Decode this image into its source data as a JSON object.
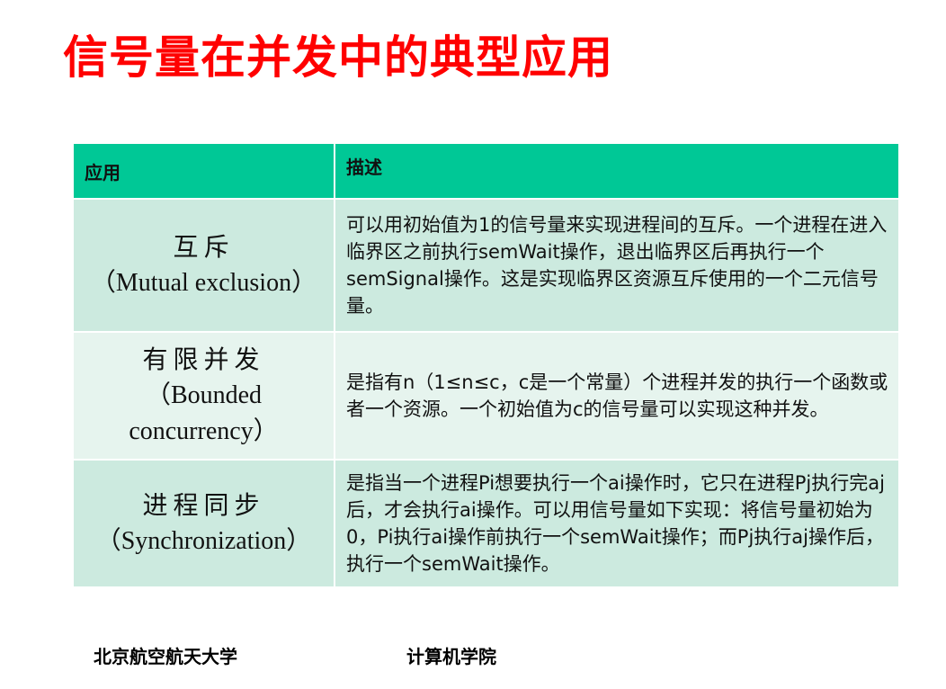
{
  "title": "信号量在并发中的典型应用",
  "table": {
    "headers": [
      "应用",
      "描述"
    ],
    "rows": [
      {
        "name_zh": "互斥",
        "name_en": "（Mutual exclusion）",
        "desc": "可以用初始值为1的信号量来实现进程间的互斥。一个进程在进入临界区之前执行semWait操作，退出临界区后再执行一个semSignal操作。这是实现临界区资源互斥使用的一个二元信号量。"
      },
      {
        "name_zh": "有限并发",
        "name_en": "（Bounded concurrency）",
        "desc": "是指有n（1≤n≤c，c是一个常量）个进程并发的执行一个函数或者一个资源。一个初始值为c的信号量可以实现这种并发。"
      },
      {
        "name_zh": "进程同步",
        "name_en": "（Synchronization）",
        "desc": "是指当一个进程Pi想要执行一个ai操作时，它只在进程Pj执行完aj后，才会执行ai操作。可以用信号量如下实现：将信号量初始为0，Pi执行ai操作前执行一个semWait操作；而Pj执行aj操作后，执行一个semWait操作。"
      }
    ]
  },
  "footer": {
    "left": "北京航空航天大学",
    "right": "计算机学院"
  }
}
